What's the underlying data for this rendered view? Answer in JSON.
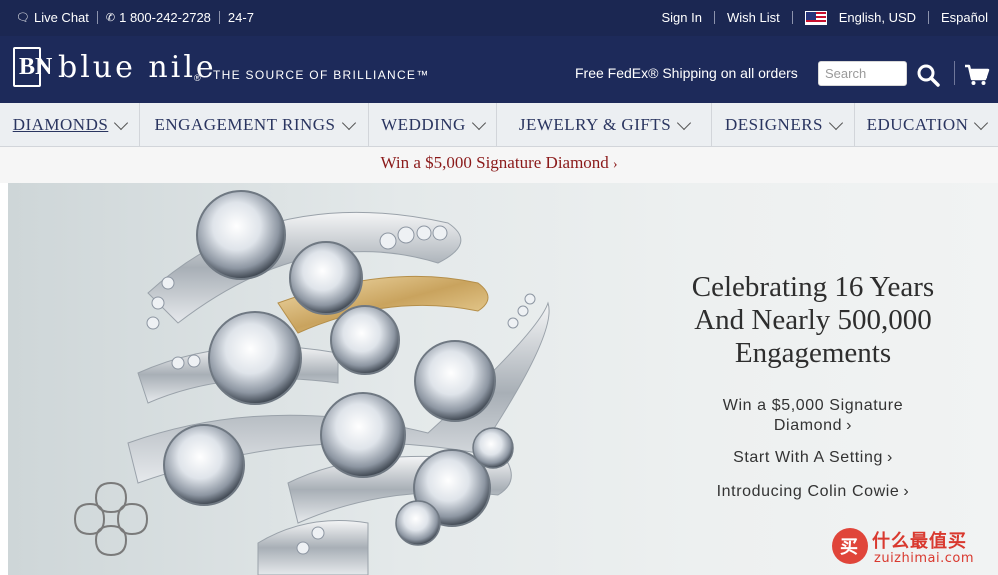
{
  "topbar": {
    "live_chat": "Live Chat",
    "phone": "1 800-242-2728",
    "hours": "24-7",
    "sign_in": "Sign In",
    "wish_list": "Wish List",
    "locale": "English, USD",
    "language": "Español"
  },
  "header": {
    "logo_text": "blue nile",
    "logo_mark": "BN",
    "logo_reg": "®",
    "tagline": "THE SOURCE OF BRILLIANCE™",
    "shipping": "Free FedEx® Shipping on all orders",
    "search_placeholder": "Search"
  },
  "nav": {
    "items": [
      {
        "label": "Diamonds"
      },
      {
        "label": "Engagement Rings"
      },
      {
        "label": "Wedding"
      },
      {
        "label": "Jewelry & Gifts"
      },
      {
        "label": "Designers"
      },
      {
        "label": "Education"
      }
    ]
  },
  "promo": {
    "text": "Win a $5,000 Signature Diamond",
    "arrow": "›"
  },
  "hero": {
    "title_line1": "Celebrating 16 Years",
    "title_line2": "And Nearly 500,000",
    "title_line3": "Engagements",
    "link1_line1": "Win a $5,000 Signature",
    "link1_line2": "Diamond",
    "link2": "Start With A Setting",
    "link3": "Introducing Colin Cowie",
    "arrow": "›"
  },
  "watermark": {
    "cn": "什么最值买",
    "site": "zuizhimai.com",
    "badge": "买"
  },
  "colors": {
    "topbar": "#1b2752",
    "header": "#1d2a5a",
    "nav_bg": "#eceff2",
    "promo_text": "#8b1a1a",
    "watermark": "#d9392f"
  }
}
